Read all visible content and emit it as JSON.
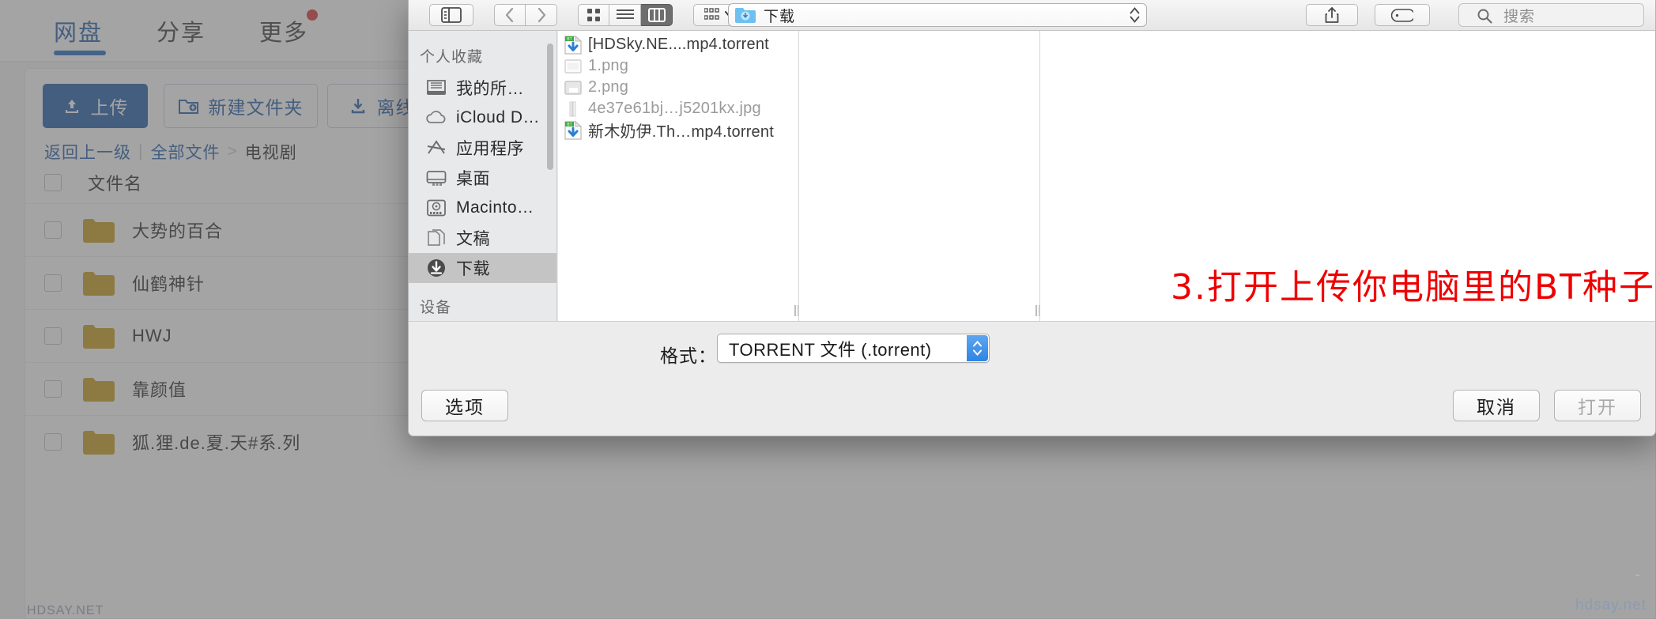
{
  "webpage": {
    "tabs": [
      {
        "label": "网盘",
        "active": true
      },
      {
        "label": "分享",
        "active": false
      },
      {
        "label": "更多",
        "active": false,
        "badge": true
      }
    ],
    "toolbar": {
      "upload_label": "上传",
      "new_folder_label": "新建文件夹",
      "offline_download_label": "离线下载"
    },
    "breadcrumb": {
      "back_label": "返回上一级",
      "root_label": "全部文件",
      "separator": ">",
      "current_label": "电视剧"
    },
    "table": {
      "header_name": "文件名",
      "rows": [
        {
          "name": "大势的百合",
          "type": "folder"
        },
        {
          "name": "仙鹤神针",
          "type": "folder"
        },
        {
          "name": "HWJ",
          "type": "folder"
        },
        {
          "name": "靠颜值",
          "type": "folder"
        },
        {
          "name": "狐.狸.de.夏.天#系.列",
          "type": "folder"
        }
      ]
    },
    "folder_color": "#c9a227"
  },
  "dialog": {
    "toolbar": {
      "sidebar_toggle_icon": "sidebar-toggle-icon",
      "back_icon": "chevron-left-icon",
      "forward_icon": "chevron-right-icon",
      "view_icons": [
        "grid-view-icon",
        "list-view-icon",
        "column-view-icon"
      ],
      "view_selected_index": 2,
      "group_icon": "group-by-icon",
      "share_icon": "share-icon",
      "tag_icon": "tag-icon",
      "search_icon": "search-icon"
    },
    "path_popup": {
      "value": "下载",
      "icon": "blue-downloads-folder-icon"
    },
    "search": {
      "placeholder": "搜索"
    },
    "sidebar": {
      "sections": [
        {
          "title": "个人收藏",
          "items": [
            {
              "label": "我的所…",
              "icon": "airdrop-icon",
              "selected": false
            },
            {
              "label": "iCloud D…",
              "icon": "cloud-icon",
              "selected": false
            },
            {
              "label": "应用程序",
              "icon": "applications-icon",
              "selected": false
            },
            {
              "label": "桌面",
              "icon": "desktop-icon",
              "selected": false
            },
            {
              "label": "Macinto…",
              "icon": "harddisk-icon",
              "selected": false
            },
            {
              "label": "文稿",
              "icon": "documents-icon",
              "selected": false
            },
            {
              "label": "下载",
              "icon": "downloads-icon",
              "selected": true
            }
          ]
        },
        {
          "title": "设备",
          "items": []
        }
      ]
    },
    "files": [
      {
        "name": "[HDSky.NE....mp4.torrent",
        "icon": "torrent-file-icon",
        "enabled": true
      },
      {
        "name": "1.png",
        "icon": "png-file-icon",
        "enabled": false
      },
      {
        "name": "2.png",
        "icon": "png-file-icon",
        "enabled": false
      },
      {
        "name": "4e37e61bj…j5201kx.jpg",
        "icon": "jpg-file-icon",
        "enabled": false
      },
      {
        "name": "新木奶伊.Th…mp4.torrent",
        "icon": "torrent-file-icon",
        "enabled": true
      }
    ],
    "annotation": {
      "text": "3.打开上传你电脑里的BT种子",
      "color": "#ef0000",
      "arrow_icon": "pink-up-arrow-icon",
      "arrow_color": "#ee5599"
    },
    "format": {
      "label": "格式：",
      "value": "TORRENT 文件 (.torrent)"
    },
    "buttons": {
      "options": "选项",
      "cancel": "取消",
      "open": "打开"
    }
  },
  "watermark": {
    "main": "hdsay.net",
    "corner": "HDSAY.NET",
    "dash": "-"
  }
}
